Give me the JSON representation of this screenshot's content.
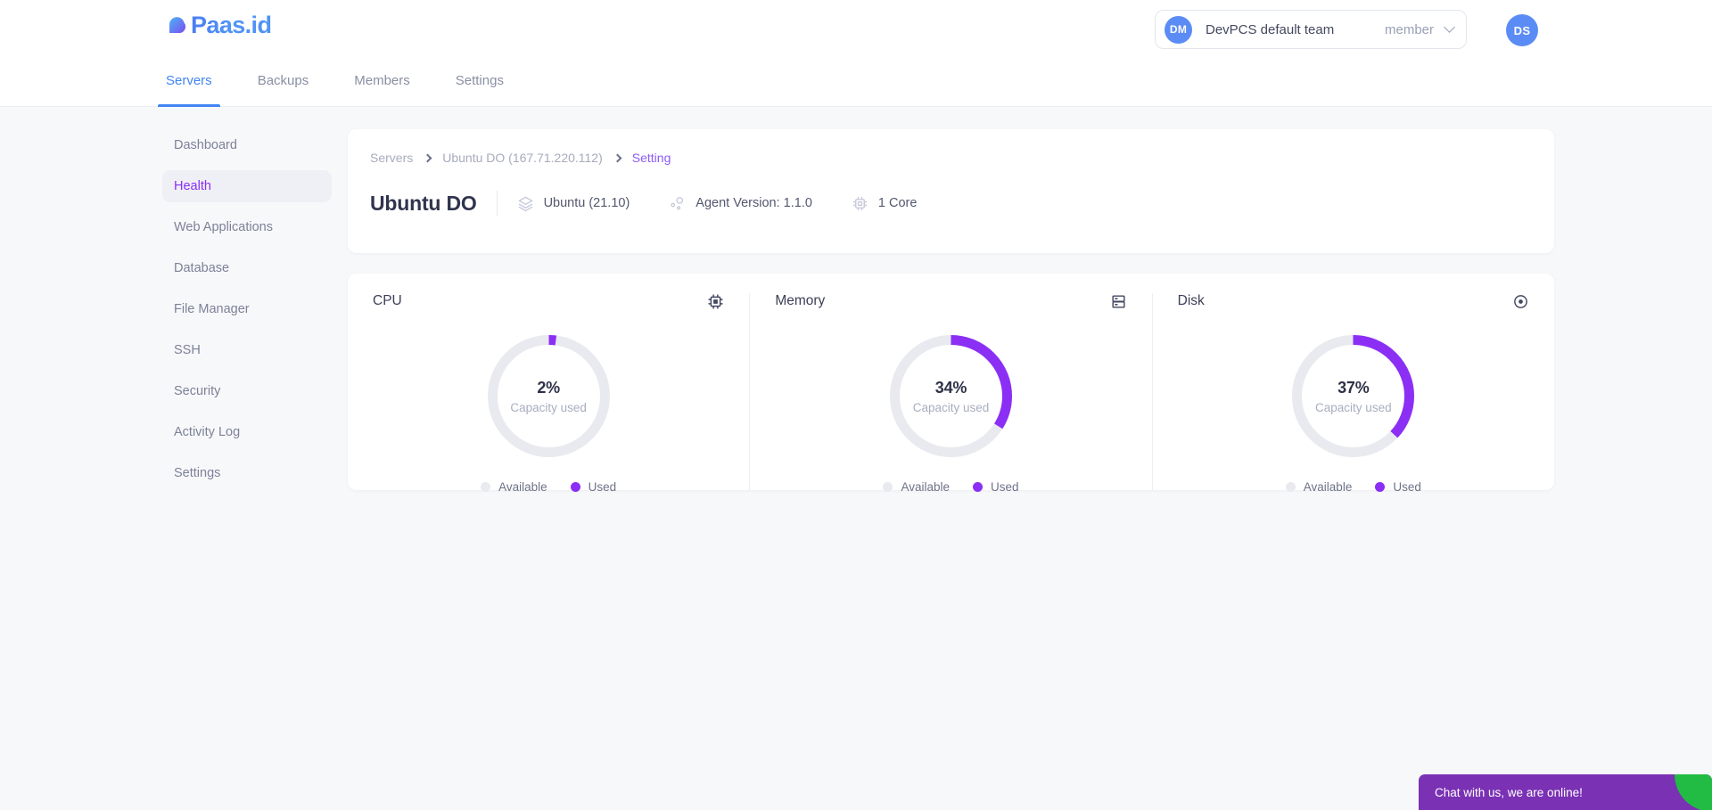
{
  "brand": {
    "name": "Paas.id",
    "logo_icon": "cloud-drop-icon",
    "accent_blue": "#4285f4",
    "accent_purple": "#8b2ff5"
  },
  "topbar": {
    "team": {
      "avatar_initials": "DM",
      "name": "DevPCS default team",
      "role": "member",
      "chevron_icon": "chevron-down-icon"
    },
    "user": {
      "avatar_initials": "DS"
    }
  },
  "nav": {
    "tabs": [
      {
        "label": "Servers",
        "active": true
      },
      {
        "label": "Backups",
        "active": false
      },
      {
        "label": "Members",
        "active": false
      },
      {
        "label": "Settings",
        "active": false
      }
    ]
  },
  "sidebar": {
    "items": [
      {
        "label": "Dashboard",
        "active": false
      },
      {
        "label": "Health",
        "active": true
      },
      {
        "label": "Web Applications",
        "active": false
      },
      {
        "label": "Database",
        "active": false
      },
      {
        "label": "File Manager",
        "active": false
      },
      {
        "label": "SSH",
        "active": false
      },
      {
        "label": "Security",
        "active": false
      },
      {
        "label": "Activity Log",
        "active": false
      },
      {
        "label": "Settings",
        "active": false
      }
    ]
  },
  "header": {
    "breadcrumb": [
      {
        "label": "Servers",
        "current": false
      },
      {
        "label": "Ubuntu DO (167.71.220.112)",
        "current": false
      },
      {
        "label": "Setting",
        "current": true
      }
    ],
    "server_name": "Ubuntu DO",
    "meta": [
      {
        "icon": "layers-icon",
        "text": "Ubuntu (21.10)"
      },
      {
        "icon": "nodes-icon",
        "text": "Agent Version: 1.1.0"
      },
      {
        "icon": "cpu-chip-icon",
        "text": "1 Core"
      }
    ]
  },
  "chart_data": [
    {
      "type": "pie",
      "title": "CPU",
      "icon": "cpu-chip-icon",
      "labels": [
        "Used",
        "Available"
      ],
      "values": [
        2,
        98
      ],
      "center_value": "2%",
      "center_label": "Capacity used",
      "colors": [
        "#8b2ff5",
        "#e9eaef"
      ],
      "legend": [
        {
          "label": "Available",
          "color": "#e9eaef"
        },
        {
          "label": "Used",
          "color": "#8b2ff5"
        }
      ],
      "legend_position": "bottom"
    },
    {
      "type": "pie",
      "title": "Memory",
      "icon": "server-rack-icon",
      "labels": [
        "Used",
        "Available"
      ],
      "values": [
        34,
        66
      ],
      "center_value": "34%",
      "center_label": "Capacity used",
      "colors": [
        "#8b2ff5",
        "#e9eaef"
      ],
      "legend": [
        {
          "label": "Available",
          "color": "#e9eaef"
        },
        {
          "label": "Used",
          "color": "#8b2ff5"
        }
      ],
      "legend_position": "bottom"
    },
    {
      "type": "pie",
      "title": "Disk",
      "icon": "disk-icon",
      "labels": [
        "Used",
        "Available"
      ],
      "values": [
        37,
        63
      ],
      "center_value": "37%",
      "center_label": "Capacity used",
      "colors": [
        "#8b2ff5",
        "#e9eaef"
      ],
      "legend": [
        {
          "label": "Available",
          "color": "#e9eaef"
        },
        {
          "label": "Used",
          "color": "#8b2ff5"
        }
      ],
      "legend_position": "bottom"
    }
  ],
  "chat": {
    "label": "Chat with us, we are online!",
    "bar_color": "#7a31b4",
    "corner_color": "#22bb44"
  }
}
